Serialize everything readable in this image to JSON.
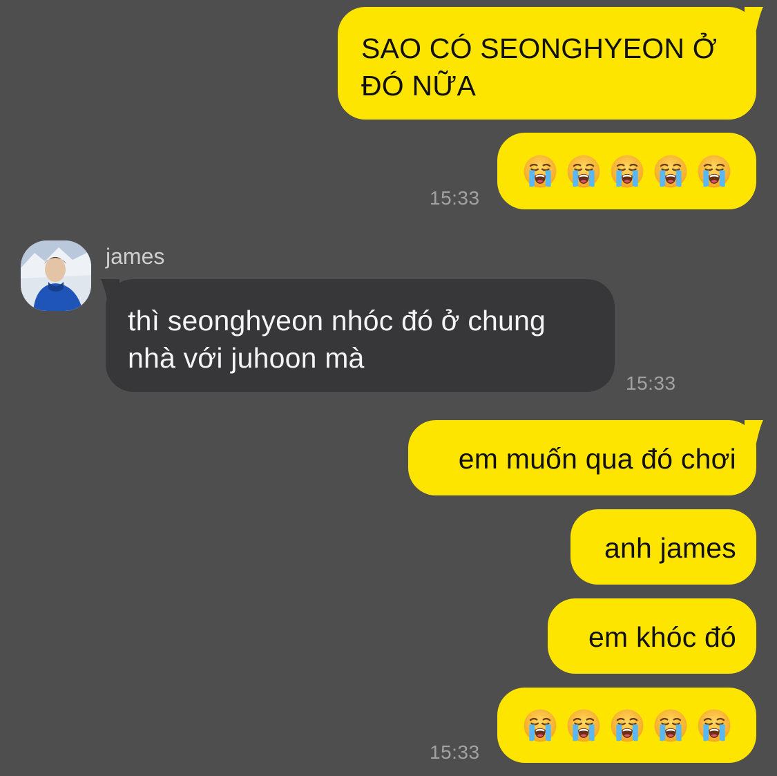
{
  "messages": [
    {
      "id": "m1",
      "side": "mine",
      "text": "SAO CÓ SEONGHYEON Ở ĐÓ NỮA"
    },
    {
      "id": "m2",
      "side": "mine",
      "emoji": "loudly-crying-face",
      "emoji_count": 5,
      "time": "15:33"
    },
    {
      "id": "m3",
      "side": "theirs",
      "sender": "james",
      "text": "thì seonghyeon nhóc đó ở chung nhà với juhoon mà",
      "time": "15:33"
    },
    {
      "id": "m4",
      "side": "mine",
      "text": "em muốn qua đó chơi"
    },
    {
      "id": "m5",
      "side": "mine",
      "text": "anh james"
    },
    {
      "id": "m6",
      "side": "mine",
      "text": "em khóc đó"
    },
    {
      "id": "m7",
      "side": "mine",
      "emoji": "loudly-crying-face",
      "emoji_count": 5,
      "time": "15:33"
    }
  ],
  "m1": {
    "line1": "SAO CÓ SEONGHYEON Ở",
    "line2": "ĐÓ NỮA"
  },
  "m2": {
    "time": "15:33"
  },
  "m3": {
    "sender": "james",
    "line1": "thì seonghyeon nhóc đó ở chung",
    "line2": "nhà với juhoon mà",
    "time": "15:33"
  },
  "m4": {
    "text": "em muốn qua đó chơi"
  },
  "m5": {
    "text": "anh james"
  },
  "m6": {
    "text": "em khóc đó"
  },
  "m7": {
    "time": "15:33"
  },
  "colors": {
    "background": "#4f4e4f",
    "my_bubble": "#fee500",
    "their_bubble": "#373638",
    "timestamp": "#a3a2a3"
  }
}
